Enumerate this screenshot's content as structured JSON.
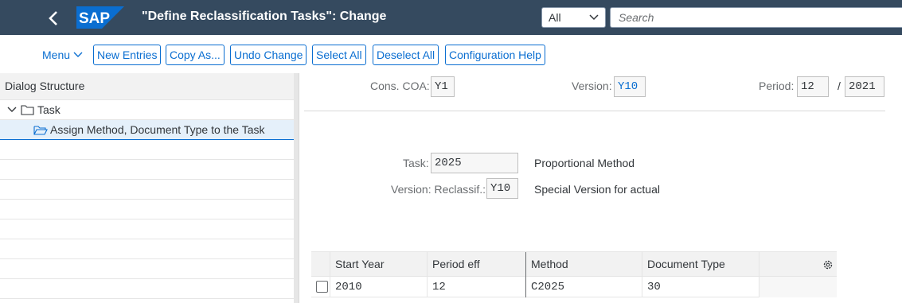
{
  "header": {
    "title": "\"Define Reclassification Tasks\": Change",
    "scope_value": "All",
    "search_placeholder": "Search",
    "logo_text": "SAP"
  },
  "toolbar": {
    "menu_label": "Menu",
    "buttons": [
      "New Entries",
      "Copy As...",
      "Undo Change",
      "Select All",
      "Deselect All",
      "Configuration Help"
    ]
  },
  "dialog_structure": {
    "heading": "Dialog Structure",
    "items": [
      {
        "label": "Task"
      },
      {
        "label": "Assign Method, Document Type to the Task"
      }
    ]
  },
  "form": {
    "cons_coa_label": "Cons. COA:",
    "cons_coa_value": "Y1",
    "version_label": "Version:",
    "version_value": "Y10",
    "period_label": "Period:",
    "period_value": "12",
    "period_sep": "/",
    "year_value": "2021",
    "task_label": "Task:",
    "task_value": "2025",
    "task_text": "Proportional Method",
    "reclass_label": "Version: Reclassif.:",
    "reclass_value": "Y10",
    "reclass_text": "Special Version for actual"
  },
  "table": {
    "columns": [
      "Start Year",
      "Period eff",
      "Method",
      "Document Type"
    ],
    "rows": [
      {
        "start_year": "2010",
        "period_eff": "12",
        "method": "C2025",
        "document_type": "30"
      }
    ]
  }
}
